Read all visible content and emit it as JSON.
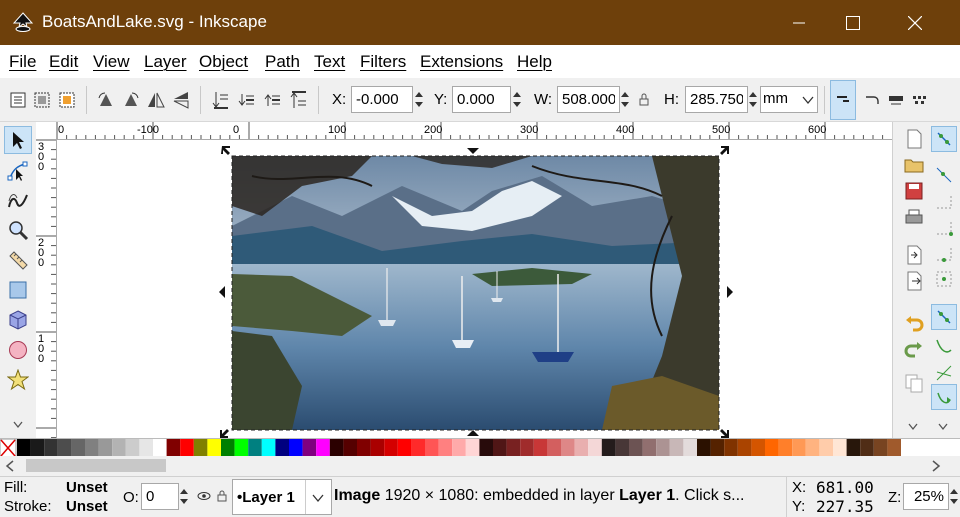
{
  "window": {
    "title": "BoatsAndLake.svg - Inkscape",
    "controls": {
      "minimize": "minimize",
      "maximize": "maximize",
      "close": "close"
    }
  },
  "menu": [
    "File",
    "Edit",
    "View",
    "Layer",
    "Object",
    "Path",
    "Text",
    "Filters",
    "Extensions",
    "Help"
  ],
  "toolbar": {
    "x_label": "X:",
    "x_value": "-0.000",
    "y_label": "Y:",
    "y_value": "0.000",
    "w_label": "W:",
    "w_value": "508.000",
    "h_label": "H:",
    "h_value": "285.750",
    "unit": "mm"
  },
  "ruler": {
    "h_ticks": [
      "0",
      "-100",
      "0",
      "100",
      "200",
      "300",
      "400",
      "500",
      "600"
    ],
    "v_ticks": [
      "3",
      "0",
      "0",
      "2",
      "0",
      "0",
      "1",
      "0",
      "0"
    ]
  },
  "tools": [
    "selector-tool",
    "node-tool",
    "tweak-tool",
    "zoom-tool",
    "measure-tool",
    "rectangle-tool",
    "3d-box-tool",
    "ellipse-tool",
    "star-tool"
  ],
  "canvas": {
    "image_alt": "Boats anchored on a mountain lake framed by trees"
  },
  "colors": {
    "titlebar": "#6e400b",
    "selection": "#cce4f7",
    "accent": "#0078d7"
  },
  "status": {
    "fill_label": "Fill:",
    "fill_value": "Unset",
    "stroke_label": "Stroke:",
    "stroke_value": "Unset",
    "opacity_label": "O:",
    "opacity_value": "0",
    "layer": "•Layer 1",
    "message_bold": "Image",
    "message_mid": " 1920 × 1080: embedded in layer ",
    "message_bold2": "Layer 1",
    "message_end": ". Click s...",
    "coord_x_label": "X:",
    "coord_x": "681.00",
    "coord_y_label": "Y:",
    "coord_y": "227.35",
    "zoom_label": "Z:",
    "zoom": "25%"
  }
}
